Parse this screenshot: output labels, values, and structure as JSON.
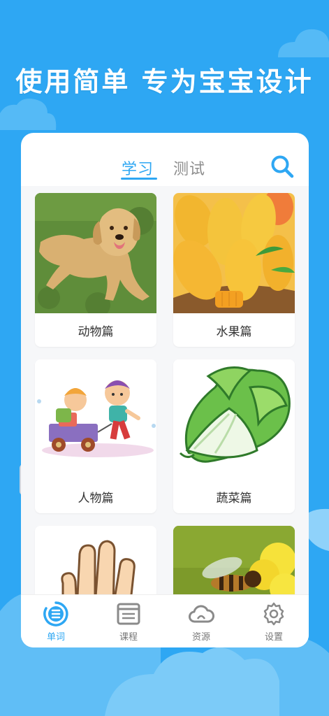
{
  "headline": "使用简单   专为宝宝设计",
  "tabs": {
    "active": "学习",
    "inactive": "测试"
  },
  "categories": [
    {
      "label": "动物篇",
      "icon": "dog-photo"
    },
    {
      "label": "水果篇",
      "icon": "mango-photo"
    },
    {
      "label": "人物篇",
      "icon": "kids-cartoon"
    },
    {
      "label": "蔬菜篇",
      "icon": "cabbage-illustration"
    },
    {
      "label": "",
      "icon": "hand-illustration"
    },
    {
      "label": "",
      "icon": "bee-photo"
    }
  ],
  "tabbar": [
    {
      "label": "单词",
      "icon": "list-icon",
      "active": true
    },
    {
      "label": "课程",
      "icon": "browser-icon",
      "active": false
    },
    {
      "label": "资源",
      "icon": "cloud-icon",
      "active": false
    },
    {
      "label": "设置",
      "icon": "gear-icon",
      "active": false
    }
  ],
  "colors": {
    "background": "#2ea7f3",
    "accent": "#2ea7f3",
    "card": "#ffffff"
  }
}
